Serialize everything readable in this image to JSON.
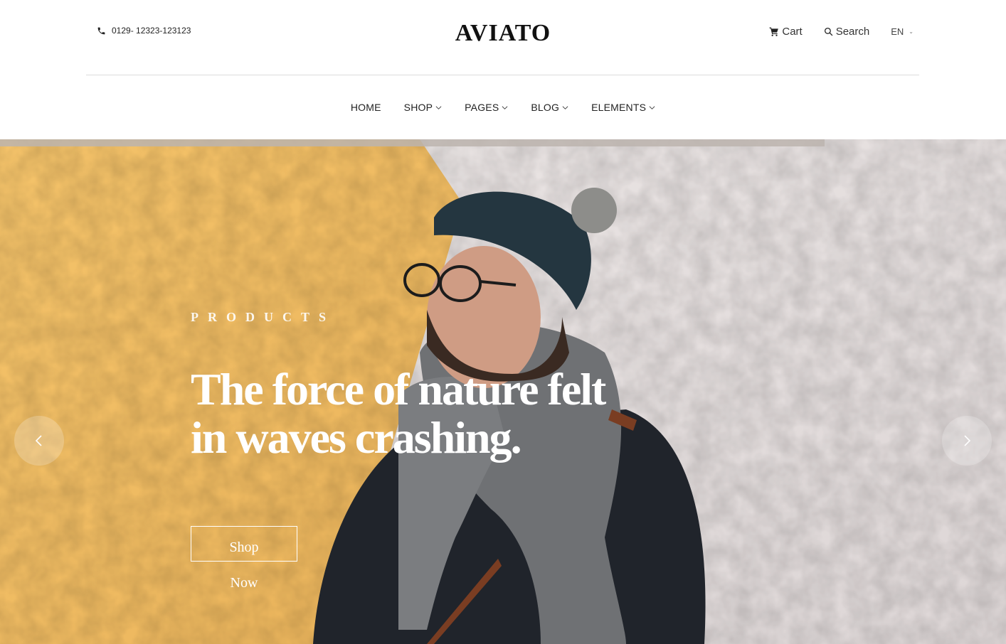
{
  "header": {
    "phone": "0129- 12323-123123",
    "logo": "AVIATO",
    "cart_label": "Cart",
    "search_label": "Search",
    "language": "EN"
  },
  "nav": {
    "items": [
      {
        "label": "HOME",
        "dropdown": false
      },
      {
        "label": "SHOP",
        "dropdown": true
      },
      {
        "label": "PAGES",
        "dropdown": true
      },
      {
        "label": "BLOG",
        "dropdown": true
      },
      {
        "label": "ELEMENTS",
        "dropdown": true
      }
    ]
  },
  "hero": {
    "subtitle": "PRODUCTS",
    "headline_line1": "The force of nature felt",
    "headline_line2": "in waves crashing.",
    "cta_line1": "Shop",
    "cta_line2": "Now",
    "slide_progress": 0.82,
    "colors": {
      "yellow_wall": "#f1be63",
      "white_wall": "#e7e2e1"
    }
  },
  "icons": {
    "phone": "phone-icon",
    "cart": "cart-icon",
    "search": "search-icon",
    "chevron": "chevron-down-icon",
    "prev": "chevron-left-icon",
    "next": "chevron-right-icon"
  }
}
